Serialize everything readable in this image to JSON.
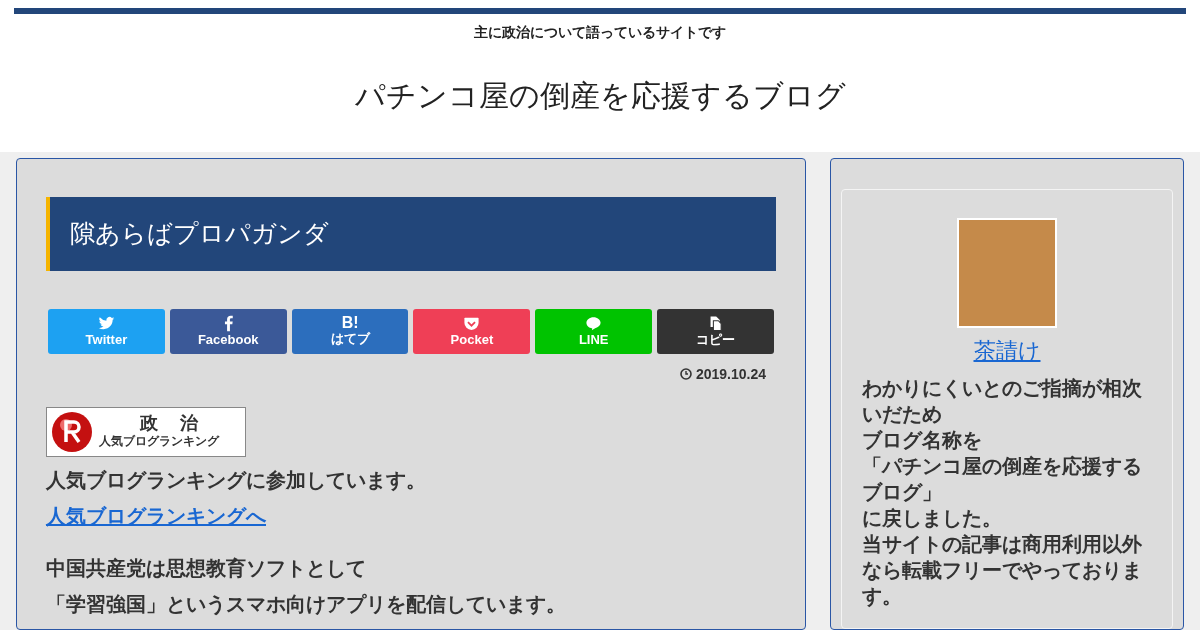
{
  "header": {
    "tagline": "主に政治について語っているサイトです",
    "site_title": "パチンコ屋の倒産を応援するブログ"
  },
  "article": {
    "title": "隙あらばプロパガンダ",
    "share_buttons": [
      {
        "kind": "twitter",
        "label": "Twitter",
        "color": "#1da1f2"
      },
      {
        "kind": "facebook",
        "label": "Facebook",
        "color": "#3b5998"
      },
      {
        "kind": "hatena",
        "label": "はてブ",
        "color": "#2c6ebd",
        "glyph": "B!"
      },
      {
        "kind": "pocket",
        "label": "Pocket",
        "color": "#ef3f56"
      },
      {
        "kind": "line",
        "label": "LINE",
        "color": "#00c300"
      },
      {
        "kind": "copy",
        "label": "コピー",
        "color": "#333333"
      }
    ],
    "date": "2019.10.24",
    "banner": {
      "line_1": "政　治",
      "line_2": "人気ブログランキング"
    },
    "paragraphs": [
      {
        "kind": "text",
        "text": "人気ブログランキングに参加しています。"
      },
      {
        "kind": "link",
        "text": "人気ブログランキングへ"
      },
      {
        "kind": "spacer"
      },
      {
        "kind": "text",
        "text": "中国共産党は思想教育ソフトとして"
      },
      {
        "kind": "text",
        "text": "「学習強国」というスマホ向けアプリを配信しています。"
      }
    ]
  },
  "sidebar": {
    "profile": {
      "name": "茶請け",
      "lines": [
        "わかりにくいとのご指摘が相次いだため",
        "ブログ名称を",
        "「パチンコ屋の倒産を応援するブログ」",
        "に戻しました。",
        "当サイトの記事は商用利用以外なら転載フリーでやっております。"
      ]
    }
  }
}
